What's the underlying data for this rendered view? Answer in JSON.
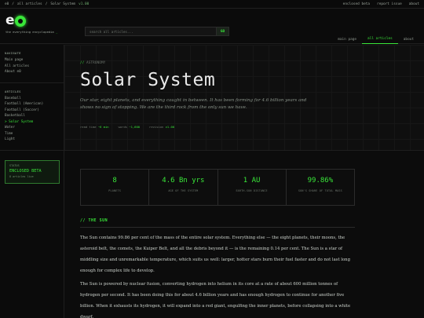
{
  "topbar": {
    "crumbs": [
      "e0",
      "/",
      "all articles",
      "/",
      "Solar System"
    ],
    "version": "v1.00",
    "links": [
      "enclosed beta",
      "report issue",
      "about"
    ]
  },
  "header": {
    "logo_letter": "e",
    "tagline": "the everything encyclopedia",
    "cursor": "_",
    "search": {
      "placeholder": "search all articles...",
      "button": "GO"
    },
    "tabs": [
      {
        "label": "main page",
        "active": false
      },
      {
        "label": "all articles",
        "active": true
      },
      {
        "label": "about",
        "active": false
      }
    ]
  },
  "sidebar": {
    "navigate_heading": "NAVIGATE",
    "navigate": [
      "Main page",
      "All articles",
      "About e0"
    ],
    "articles_heading": "ARTICLES",
    "articles": [
      {
        "label": "Baseball",
        "active": false
      },
      {
        "label": "Football (American)",
        "active": false
      },
      {
        "label": "Football (Soccer)",
        "active": false
      },
      {
        "label": "Basketball",
        "active": false
      },
      {
        "label": "> Solar System",
        "active": true
      },
      {
        "label": "Water",
        "active": false
      },
      {
        "label": "Time",
        "active": false
      },
      {
        "label": "Light",
        "active": false
      }
    ],
    "status": {
      "label": "STATUS",
      "title": "ENCLOSED BETA",
      "sub": "8 articles live"
    }
  },
  "article": {
    "eyebrow_prefix": "//",
    "eyebrow": "ASTRONOMY",
    "title": "Solar System",
    "lede": "Our star, eight planets, and everything caught in between. It has been forming for 4.6 billion years and shows no sign of stopping. We are the third rock from the only sun we have.",
    "meta": [
      {
        "label": "read time",
        "value": "~6 min"
      },
      {
        "label": "words",
        "value": "~1,600"
      },
      {
        "label": "revision",
        "value": "v1.00"
      }
    ],
    "stats": [
      {
        "num": "8",
        "label": "PLANETS"
      },
      {
        "num": "4.6 Bn yrs",
        "label": "AGE OF THE SYSTEM"
      },
      {
        "num": "1 AU",
        "label": "EARTH-SUN DISTANCE"
      },
      {
        "num": "99.86%",
        "label": "SUN'S SHARE OF TOTAL MASS"
      }
    ],
    "section_title": "// THE SUN",
    "paragraphs": [
      "The Sun contains 99.86 per cent of the mass of the entire solar system. Everything else — the eight planets, their moons, the asteroid belt, the comets, the Kuiper Belt, and all the debris beyond it — is the remaining 0.14 per cent. The Sun is a star of middling size and unremarkable temperature, which suits us well: larger, hotter stars burn their fuel faster and do not last long enough for complex life to develop.",
      "The Sun is powered by nuclear fusion, converting hydrogen into helium in its core at a rate of about 600 million tonnes of hydrogen per second. It has been doing this for about 4.6 billion years and has enough hydrogen to continue for another five billion. When it exhausts its hydrogen, it will expand into a red giant, engulfing the inner planets, before collapsing into a white dwarf."
    ]
  },
  "colors": {
    "accent": "#39e639",
    "background": "#0c0c0c"
  }
}
